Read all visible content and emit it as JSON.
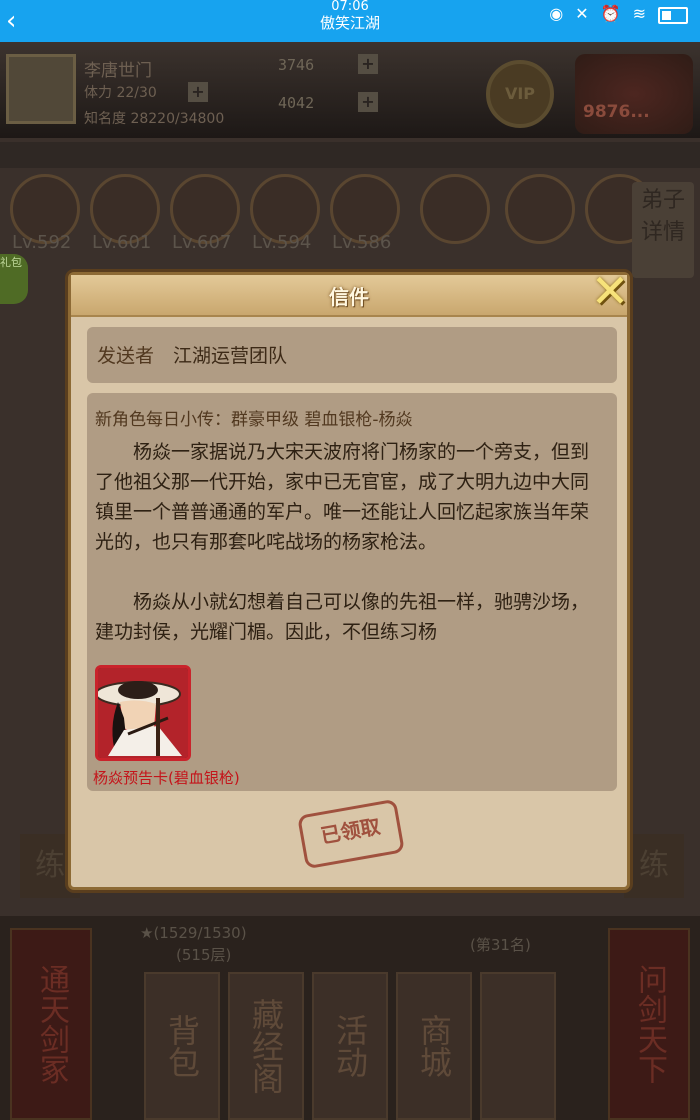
{
  "status_bar": {
    "time": "07:06",
    "title": "傲笑江湖",
    "back_icon": "chevron-left-icon"
  },
  "player": {
    "name": "李唐世门",
    "stamina": "体力 22/30",
    "fame": "知名度 28220/34800"
  },
  "resources": {
    "silver": "3746",
    "gold": "4042"
  },
  "vip": "VIP",
  "power": "9876...",
  "heroes": [
    {
      "level": "Lv.592"
    },
    {
      "level": "Lv.601"
    },
    {
      "level": "Lv.607"
    },
    {
      "level": "Lv.594"
    },
    {
      "level": "Lv.586"
    }
  ],
  "disciple_button": "弟子详情",
  "gift_label": "礼包",
  "bottom": {
    "left_scroll": "通天剑冢",
    "right_scroll": "问剑天下",
    "star_progress": "★(1529/1530)",
    "floor": "(515层)",
    "rank": "(第31名)",
    "buttons": [
      "背包",
      "藏经阁",
      "活动",
      "商城"
    ],
    "lian": "练"
  },
  "dialog": {
    "title": "信件",
    "sender_label": "发送者",
    "sender_name": "江湖运营团队",
    "subject": "新角色每日小传：群豪甲级 碧血银枪-杨焱",
    "paragraphs": [
      "杨焱一家据说乃大宋天波府将门杨家的一个旁支，但到了他祖父那一代开始，家中已无官宦，成了大明九边中大同镇里一个普普通通的军户。唯一还能让人回忆起家族当年荣光的，也只有那套叱咤战场的杨家枪法。",
      "杨焱从小就幻想着自己可以像的先祖一样，驰骋沙场，建功封侯，光耀门楣。因此，不但练习杨"
    ],
    "attachment_caption": "杨焱预告卡(碧血银枪)",
    "stamp": "已领取",
    "close_icon": "close-x-icon"
  }
}
